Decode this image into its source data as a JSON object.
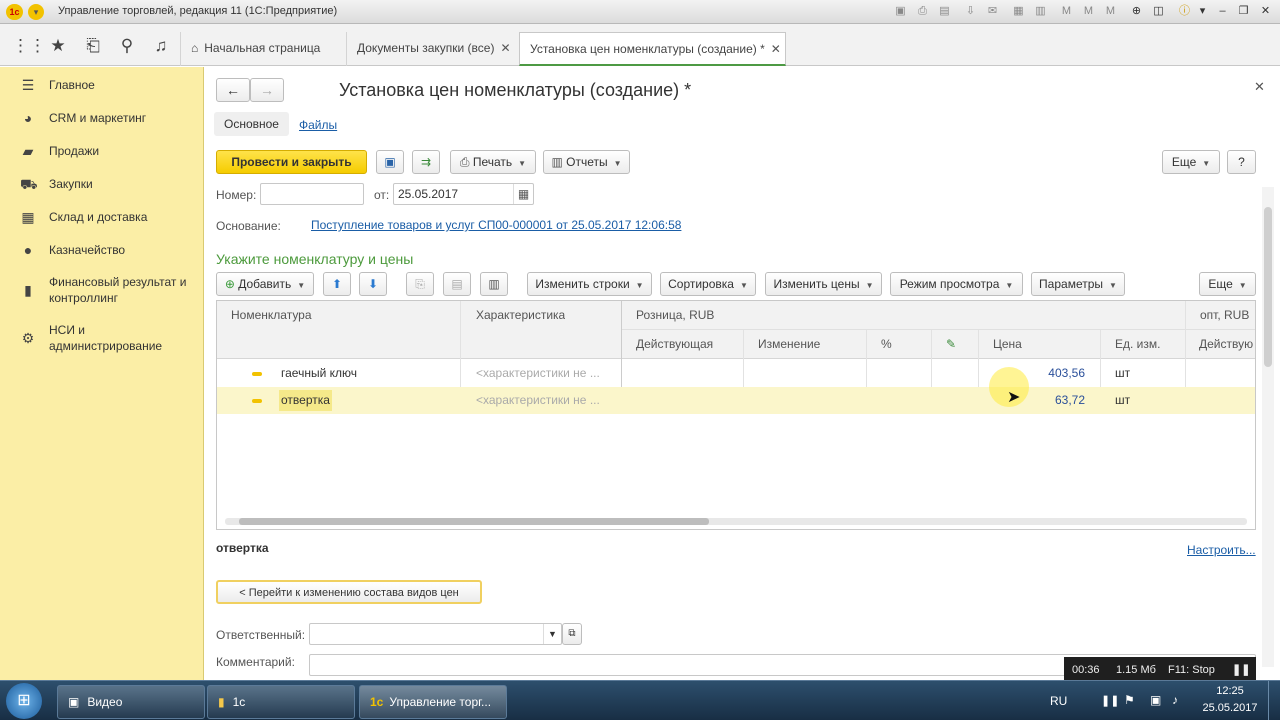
{
  "titlebar": {
    "title": "Управление торговлей, редакция 11  (1С:Предприятие)",
    "logo": "1с"
  },
  "tabs": [
    {
      "label": "Начальная страница"
    },
    {
      "label": "Документы закупки (все)"
    },
    {
      "label": "Установка цен номенклатуры (создание) *"
    }
  ],
  "sidebar": {
    "items": [
      {
        "label": "Главное",
        "icon": "menu-icon"
      },
      {
        "label": "CRM и маркетинг",
        "icon": "pie-icon"
      },
      {
        "label": "Продажи",
        "icon": "bag-icon"
      },
      {
        "label": "Закупки",
        "icon": "cart-icon"
      },
      {
        "label": "Склад и доставка",
        "icon": "warehouse-icon"
      },
      {
        "label": "Казначейство",
        "icon": "coin-icon"
      },
      {
        "label": "Финансовый результат и контроллинг",
        "icon": "chart-icon"
      },
      {
        "label": "НСИ и администрирование",
        "icon": "gear-icon"
      }
    ]
  },
  "form": {
    "title": "Установка цен номенклатуры (создание) *",
    "tab_main": "Основное",
    "tab_files": "Файлы",
    "btn_post_close": "Провести и закрыть",
    "btn_print": "Печать",
    "btn_reports": "Отчеты",
    "btn_more": "Еще",
    "btn_help": "?",
    "number_label": "Номер:",
    "number_value": "",
    "date_label": "от:",
    "date_value": "25.05.2017",
    "basis_label": "Основание:",
    "basis_link": "Поступление товаров и услуг СП00-000001 от 25.05.2017 12:06:58",
    "section_title": "Укажите номенклатуру и цены",
    "btn_add": "Добавить",
    "btn_change_rows": "Изменить строки",
    "btn_sort": "Сортировка",
    "btn_change_prices": "Изменить цены",
    "btn_view_mode": "Режим просмотра",
    "btn_params": "Параметры",
    "btn_more2": "Еще"
  },
  "grid": {
    "col_item": "Номенклатура",
    "col_char": "Характеристика",
    "group_retail": "Розница, RUB",
    "group_opt": "опт, RUB",
    "sub_current": "Действующая",
    "sub_change": "Изменение",
    "sub_percent": "%",
    "sub_price": "Цена",
    "sub_unit": "Ед. изм.",
    "sub_current2": "Действую",
    "rows": [
      {
        "item": "гаечный ключ",
        "char": "<характеристики не ...",
        "price": "403,56",
        "unit": "шт"
      },
      {
        "item": "отвертка",
        "char": "<характеристики не ...",
        "price": "63,72",
        "unit": "шт"
      }
    ]
  },
  "footer": {
    "selected_item": "отвертка",
    "configure_link": "Настроить...",
    "btn_goto": "< Перейти к изменению состава видов цен",
    "responsible_label": "Ответственный:",
    "comment_label": "Комментарий:"
  },
  "recorder": {
    "time": "00:36",
    "size": "1.15 Мб",
    "hint": "F11: Stop"
  },
  "taskbar": {
    "items": [
      {
        "label": "Видео"
      },
      {
        "label": "1с"
      },
      {
        "label": "Управление торг..."
      }
    ],
    "lang": "RU",
    "time": "12:25",
    "date": "25.05.2017"
  }
}
